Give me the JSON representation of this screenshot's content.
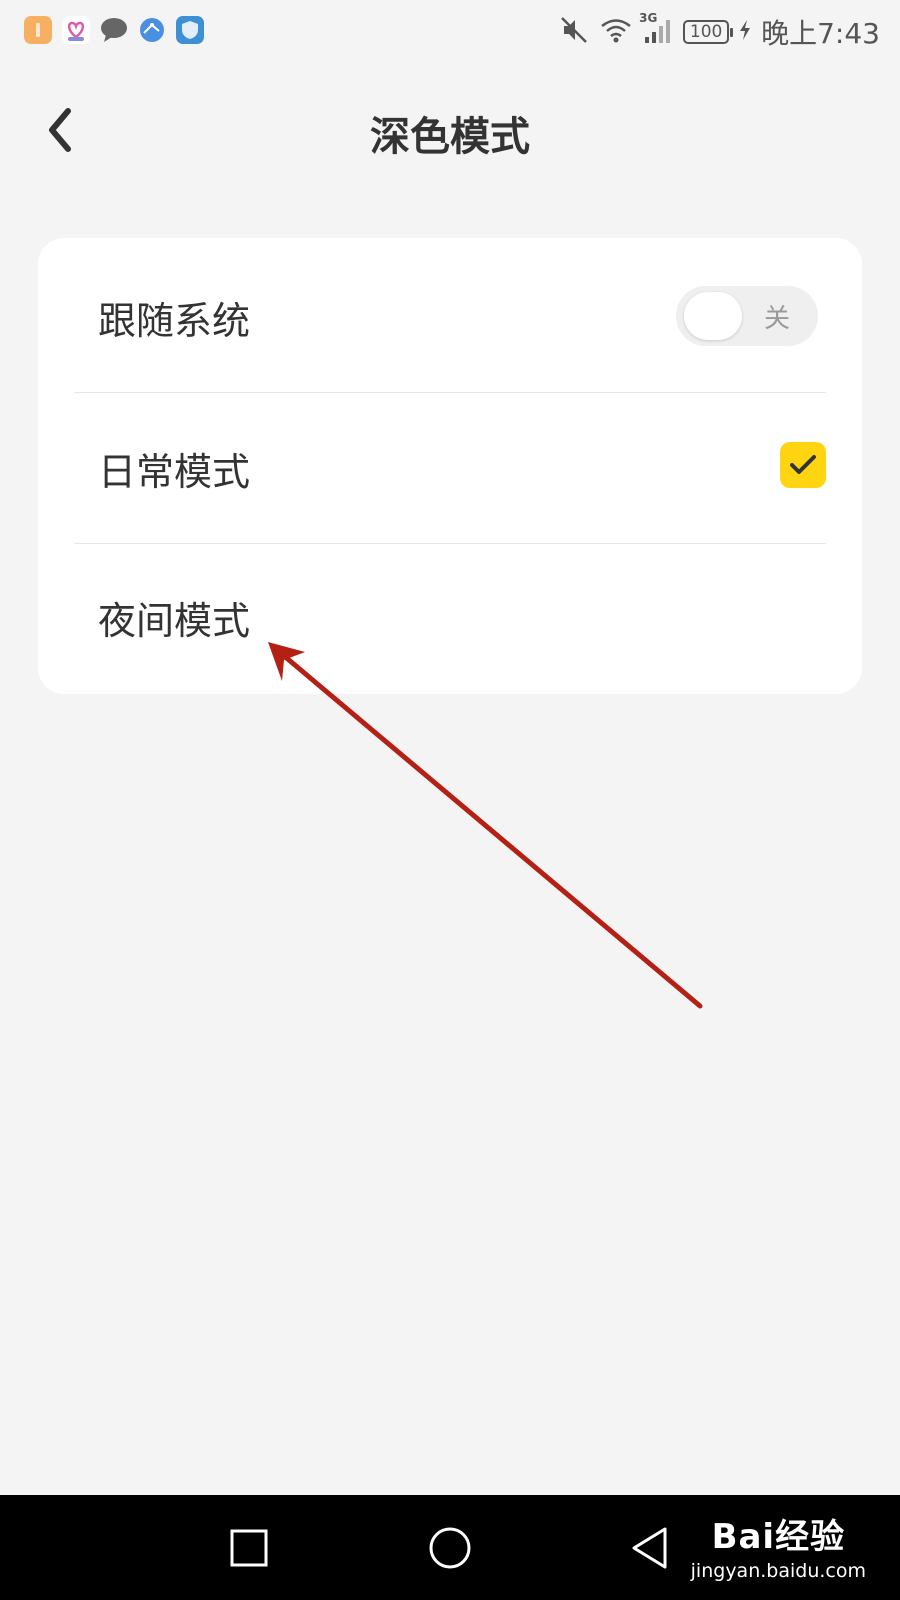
{
  "status_bar": {
    "time": "晚上7:43",
    "battery": "100",
    "network": "3G",
    "app_icons": [
      "orange-app-icon",
      "heart-app-icon",
      "chat-app-icon",
      "browser-app-icon",
      "shield-app-icon"
    ],
    "status_icons": [
      "mute-icon",
      "wifi-icon",
      "signal-icon",
      "charging-icon"
    ]
  },
  "header": {
    "title": "深色模式",
    "back_icon": "chevron-left-icon"
  },
  "settings": {
    "follow_system": {
      "label": "跟随系统",
      "toggle_text": "关",
      "enabled": false
    },
    "normal_mode": {
      "label": "日常模式",
      "selected": true
    },
    "night_mode": {
      "label": "夜间模式",
      "selected": false
    }
  },
  "colors": {
    "background": "#f4f4f4",
    "card": "#ffffff",
    "accent": "#ffd512",
    "annotation_arrow": "#b52015"
  },
  "annotation": {
    "type": "arrow",
    "target": "night_mode"
  },
  "nav_bar": {
    "buttons": [
      "recent-apps-icon",
      "home-icon",
      "back-triangle-icon"
    ]
  },
  "watermark": {
    "brand": "Bai经验",
    "url": "jingyan.baidu.com"
  }
}
